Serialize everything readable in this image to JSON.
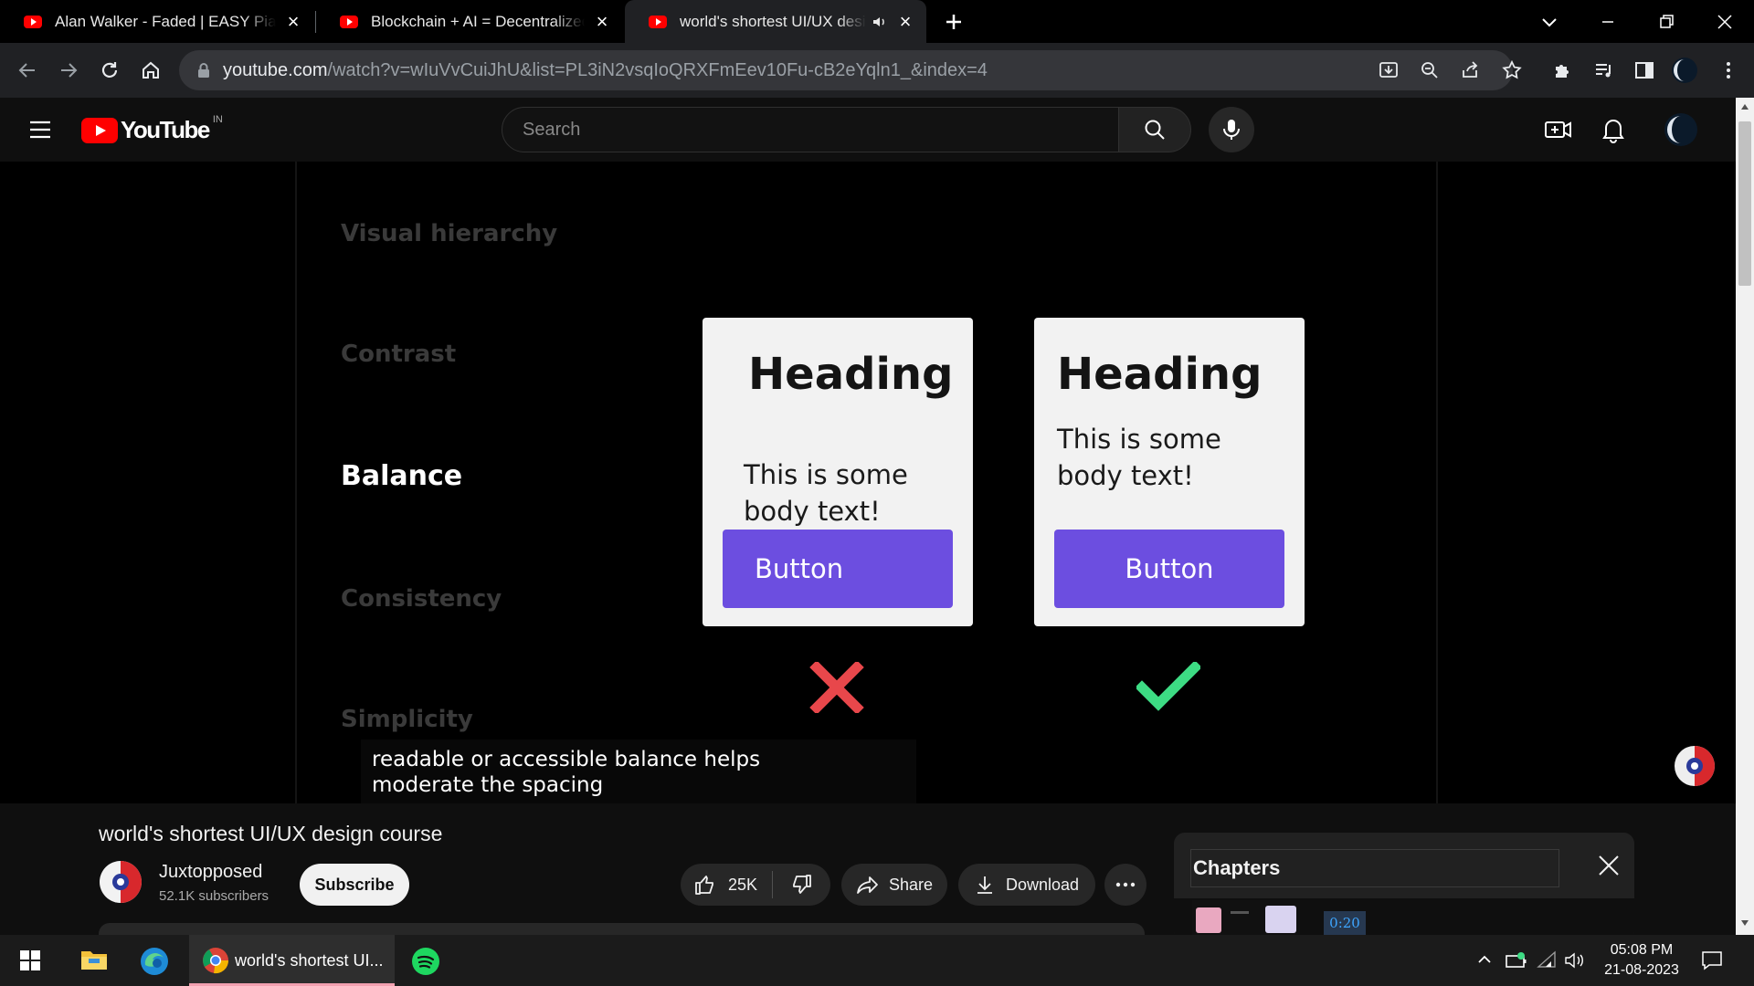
{
  "browser": {
    "tabs": [
      {
        "title": "Alan Walker - Faded | EASY Piano",
        "active": false
      },
      {
        "title": "Blockchain + AI = Decentralized AI",
        "active": false
      },
      {
        "title": "world's shortest UI/UX design course",
        "active": true
      }
    ],
    "url_host": "youtube.com",
    "url_path": "/watch?v=wIuVvCuiJhU&list=PL3iN2vsqIoQRXFmEev10Fu-cB2eYqln1_&index=4"
  },
  "youtube": {
    "logo_text": "YouTube",
    "country_code": "IN",
    "search_placeholder": "Search"
  },
  "video": {
    "topics": [
      "Visual hierarchy",
      "Contrast",
      "Balance",
      "Consistency",
      "Simplicity"
    ],
    "current_topic": "Balance",
    "bad_card": {
      "heading": "Heading",
      "body": "This is some body text!",
      "button": "Button"
    },
    "good_card": {
      "heading": "Heading",
      "body": "This is some body text!",
      "button": "Button"
    },
    "caption_line1": "readable or accessible balance helps",
    "caption_line2": "moderate the spacing",
    "accent_color": "#6c4ee0",
    "bad_color": "#e8474b",
    "good_color": "#3ddc84"
  },
  "details": {
    "title": "world's shortest UI/UX design course",
    "channel": "Juxtopposed",
    "subscribers": "52.1K subscribers",
    "subscribe_label": "Subscribe",
    "likes": "25K",
    "share_label": "Share",
    "download_label": "Download",
    "chapters_title": "Chapters",
    "chapter_time": "0:20"
  },
  "taskbar": {
    "active_window": "world's shortest UI...",
    "time": "05:08 PM",
    "date": "21-08-2023"
  }
}
